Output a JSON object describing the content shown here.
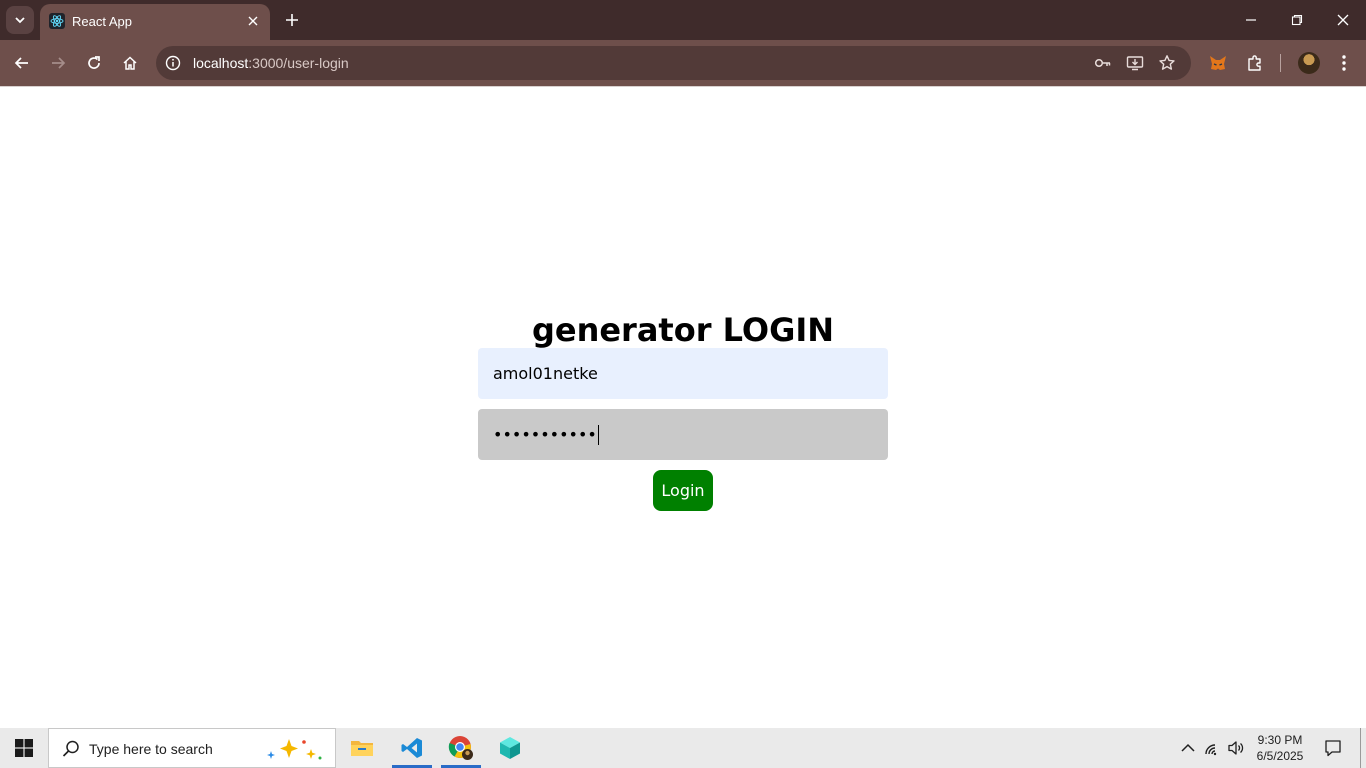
{
  "browser": {
    "tab_title": "React App",
    "url_host": "localhost",
    "url_rest": ":3000/user-login"
  },
  "page": {
    "title": "generator LOGIN",
    "username_value": "amol01netke",
    "password_masked": "•••••••••••",
    "login_label": "Login"
  },
  "taskbar": {
    "search_placeholder": "Type here to search",
    "time": "9:30 PM",
    "date": "6/5/2025"
  },
  "colors": {
    "tabbar": "#3f2b2b",
    "toolbar": "#6e4f4b",
    "username_bg": "#e8f0fe",
    "password_bg": "#c9c9c9",
    "login_button": "#008000"
  }
}
